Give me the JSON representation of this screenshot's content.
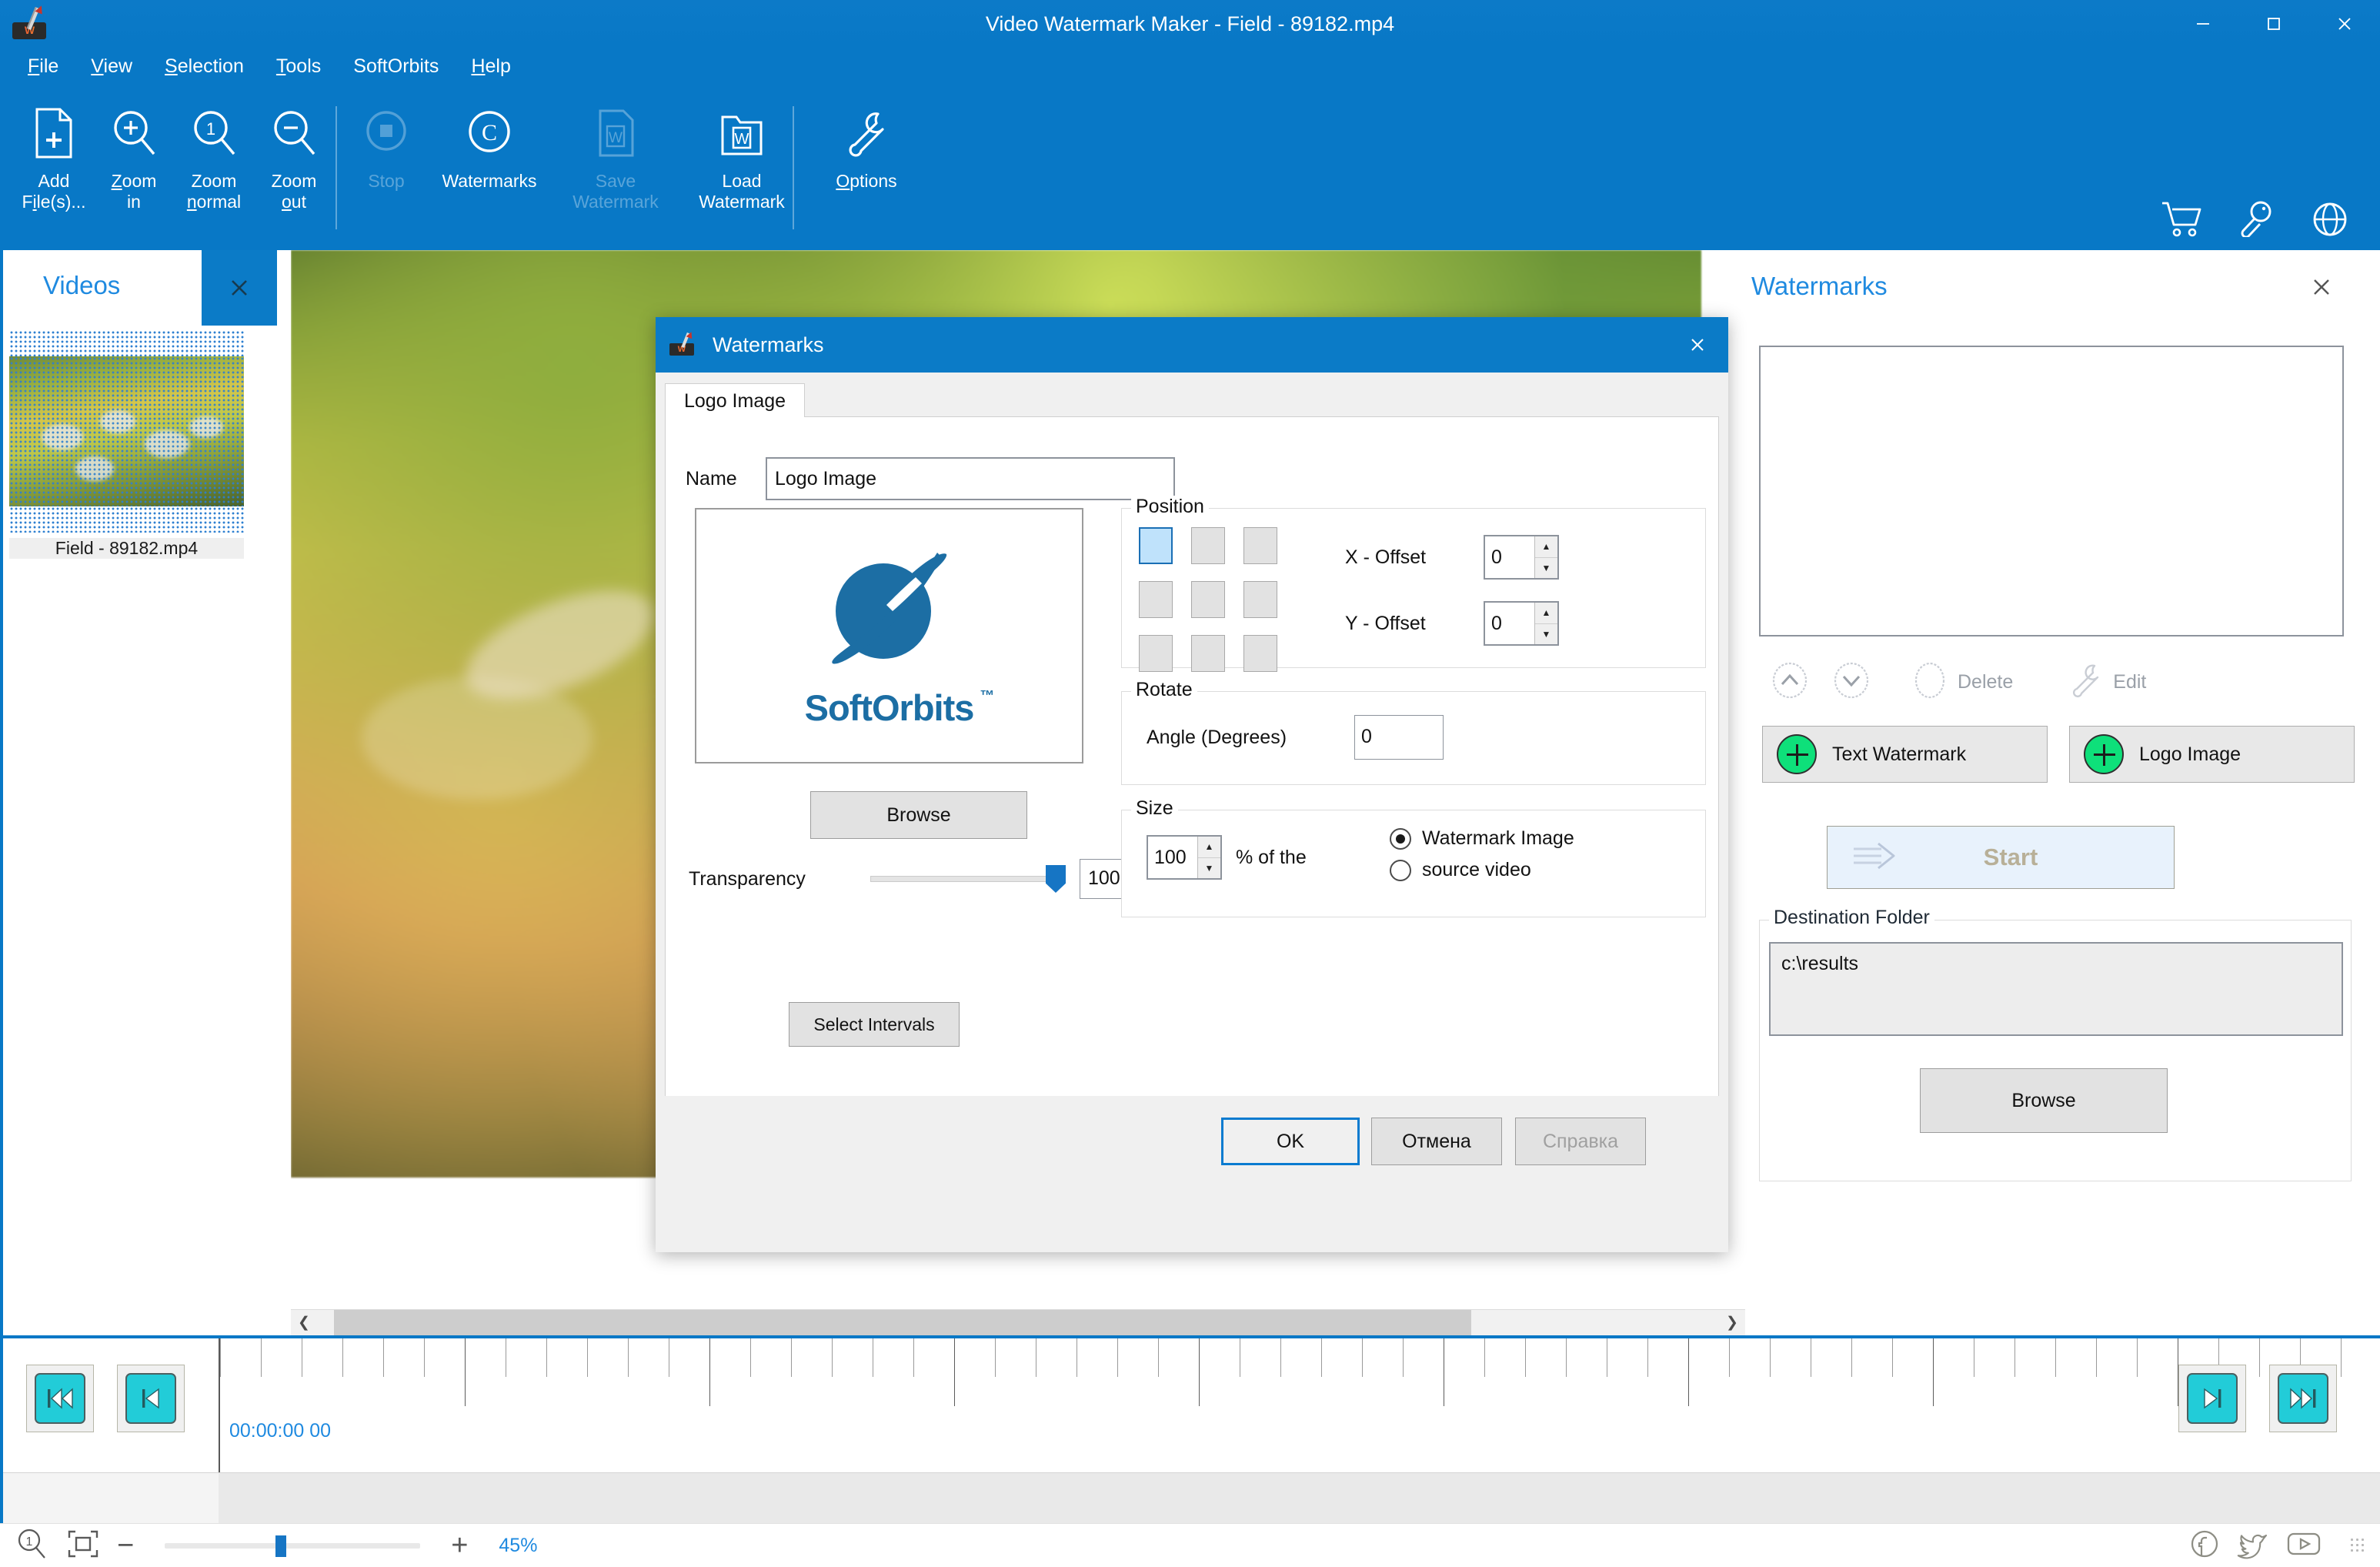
{
  "window": {
    "title": "Video Watermark Maker - Field - 89182.mp4",
    "app_icon": "watermark-app-icon",
    "minimize": "–",
    "maximize": "❐",
    "close": "✕"
  },
  "menubar": {
    "items": [
      {
        "label": "File",
        "accel": "F"
      },
      {
        "label": "View",
        "accel": "V"
      },
      {
        "label": "Selection",
        "accel": "S"
      },
      {
        "label": "Tools",
        "accel": "T"
      },
      {
        "label": "SoftOrbits",
        "accel": ""
      },
      {
        "label": "Help",
        "accel": "H"
      }
    ]
  },
  "toolbar": {
    "buttons": [
      {
        "label": "Add\nFile(s)...",
        "icon": "add-file-icon",
        "enabled": true
      },
      {
        "label": "Zoom\nin",
        "icon": "zoom-in-icon",
        "enabled": true
      },
      {
        "label": "Zoom\nnormal",
        "icon": "zoom-normal-icon",
        "enabled": true
      },
      {
        "label": "Zoom\nout",
        "icon": "zoom-out-icon",
        "enabled": true
      },
      {
        "label": "Stop",
        "icon": "stop-icon",
        "enabled": false
      },
      {
        "label": "Watermarks",
        "icon": "copyright-icon",
        "enabled": true
      },
      {
        "label": "Save\nWatermark",
        "icon": "save-watermark-icon",
        "enabled": false
      },
      {
        "label": "Load\nWatermark",
        "icon": "load-watermark-icon",
        "enabled": true
      },
      {
        "label": "Options",
        "icon": "wrench-icon",
        "enabled": true
      }
    ],
    "right_icons": [
      "cart-icon",
      "key-icon",
      "globe-icon"
    ]
  },
  "videos_panel": {
    "title": "Videos",
    "close_icon": "close-icon",
    "items": [
      {
        "label": "Field - 89182.mp4",
        "selected": true
      }
    ]
  },
  "canvas": {
    "scroll_left_icon": "chevron-left-icon",
    "scroll_right_icon": "chevron-right-icon"
  },
  "watermarks_panel": {
    "title": "Watermarks",
    "close_icon": "close-icon",
    "list_items": [],
    "tools": [
      {
        "icon": "move-up-icon",
        "label": ""
      },
      {
        "icon": "move-down-icon",
        "label": ""
      },
      {
        "icon": "delete-circle-icon",
        "label": "Delete"
      },
      {
        "icon": "wrench-icon",
        "label": "Edit"
      }
    ],
    "delete_label": "Delete",
    "edit_label": "Edit",
    "add_text_label": "Text Watermark",
    "add_logo_label": "Logo Image",
    "start_label": "Start",
    "start_icon": "arrow-right-icon",
    "destination": {
      "legend": "Destination Folder",
      "path": "c:\\results",
      "browse_label": "Browse"
    }
  },
  "dialog": {
    "title": "Watermarks",
    "icon": "watermark-app-icon",
    "close_icon": "close-icon",
    "tabs": [
      {
        "label": "Logo Image",
        "active": true
      }
    ],
    "name_label": "Name",
    "name_value": "Logo Image",
    "logo_preview": {
      "brand": "SoftOrbits",
      "trademark": "™",
      "icon": "softorbits-planet-icon"
    },
    "browse_label": "Browse",
    "transparency_label": "Transparency",
    "transparency_value": "100",
    "select_intervals_label": "Select Intervals",
    "position": {
      "legend": "Position",
      "selected_cell": 0,
      "cells": 9,
      "x_offset_label": "X - Offset",
      "x_offset_value": "0",
      "y_offset_label": "Y - Offset",
      "y_offset_value": "0"
    },
    "rotate": {
      "legend": "Rotate",
      "angle_label": "Angle (Degrees)",
      "angle_value": "0"
    },
    "size": {
      "legend": "Size",
      "value": "100",
      "percent_label": "% of the",
      "options": [
        {
          "label": "Watermark Image",
          "selected": true
        },
        {
          "label": "source video",
          "selected": false
        }
      ]
    },
    "footer": {
      "ok_label": "OK",
      "cancel_label": "Отмена",
      "help_label": "Справка",
      "help_enabled": false
    }
  },
  "transport": {
    "timecode": "00:00:00 00",
    "buttons_left": [
      {
        "icon": "skip-to-start-icon"
      },
      {
        "icon": "step-back-icon"
      }
    ],
    "buttons_right": [
      {
        "icon": "step-forward-icon"
      },
      {
        "icon": "skip-to-end-icon"
      }
    ]
  },
  "statusbar": {
    "zoom_icon": "zoom-one-icon",
    "fit_icon": "fit-to-window-icon",
    "minus_label": "−",
    "plus_label": "+",
    "zoom_percent": "45%",
    "social": [
      "facebook-icon",
      "twitter-icon",
      "youtube-icon"
    ]
  },
  "colors": {
    "accent": "#0878c6",
    "panel_title": "#1f8ae0",
    "cyan_button": "#22ccd8",
    "green_plus": "#0ee07a",
    "logo_blue": "#1c6ea4"
  }
}
